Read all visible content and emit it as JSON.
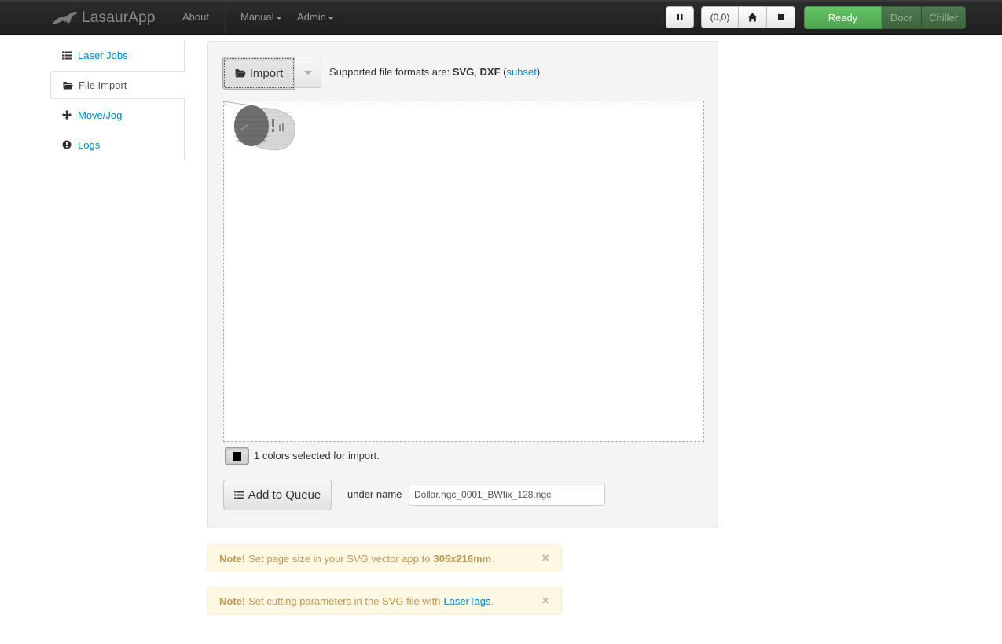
{
  "navbar": {
    "brand": "LasaurApp",
    "about": "About",
    "manual": "Manual",
    "admin": "Admin",
    "pause_icon": "pause-icon",
    "coords_label": "(0,0)",
    "home_icon": "home-icon",
    "stop_icon": "stop-icon",
    "status": {
      "ready": "Ready",
      "door": "Door",
      "chiller": "Chiller",
      "ready_color": "#51a351"
    }
  },
  "sidebar": {
    "items": [
      {
        "label": "Laser Jobs",
        "icon": "list-icon"
      },
      {
        "label": "File Import",
        "icon": "folder-open-icon"
      },
      {
        "label": "Move/Jog",
        "icon": "move-icon"
      },
      {
        "label": "Logs",
        "icon": "exclamation-circle-icon"
      }
    ]
  },
  "import": {
    "button_label": "Import",
    "formats_prefix": "Supported file formats are:",
    "format_svg": "SVG",
    "format_sep": ",",
    "format_dxf": "DXF",
    "paren_open": "(",
    "subset_link": "subset",
    "paren_close": ")",
    "colors_selected": "1 colors selected for import.",
    "selected_color": "#000000",
    "add_to_queue": "Add to Queue",
    "under_name_label": "under name",
    "job_name": "Dollar.ngc_0001_BWfix_128.ngc"
  },
  "alerts": [
    {
      "note": "Note!",
      "text_before": "Set page size in your SVG vector app to",
      "value": "305x216mm",
      "text_after": ".",
      "close": "×"
    },
    {
      "note": "Note!",
      "text_before": "Set cutting parameters in the SVG file with",
      "link": "LaserTags",
      "text_after": ".",
      "close": "×"
    }
  ]
}
